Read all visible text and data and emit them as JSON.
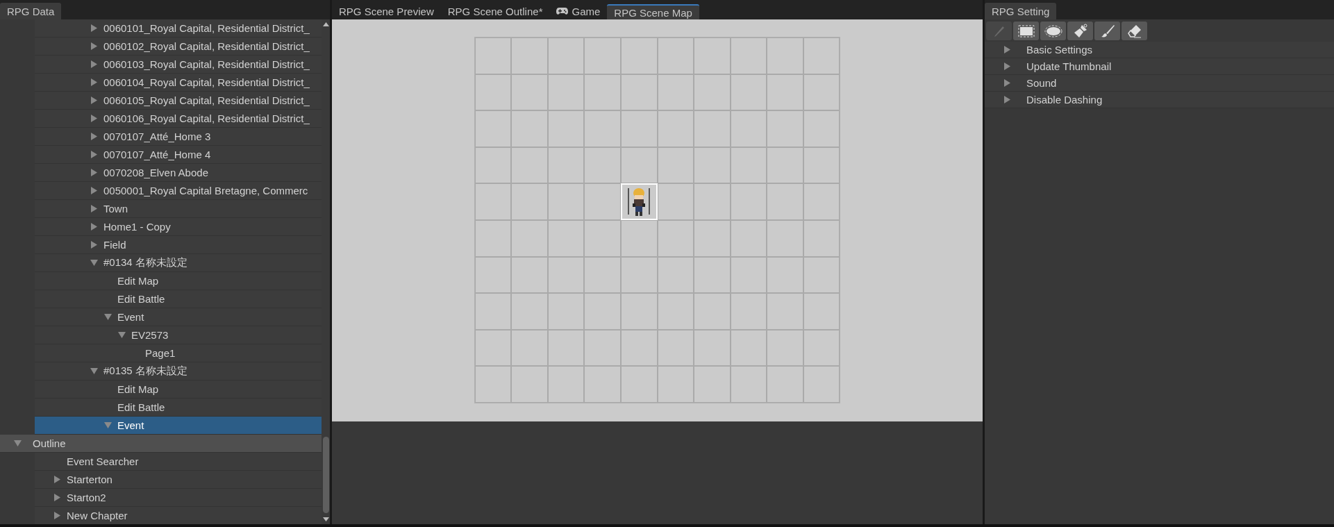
{
  "left_panel": {
    "tab": {
      "label": "RPG Data",
      "selected": true
    },
    "tree": [
      {
        "label": "0060101_Royal Capital, Residential District_",
        "kind": "node",
        "expanded": false,
        "selected": false
      },
      {
        "label": "0060102_Royal Capital, Residential District_",
        "kind": "node",
        "expanded": false,
        "selected": false
      },
      {
        "label": "0060103_Royal Capital, Residential District_",
        "kind": "node",
        "expanded": false,
        "selected": false
      },
      {
        "label": "0060104_Royal Capital, Residential District_",
        "kind": "node",
        "expanded": false,
        "selected": false
      },
      {
        "label": "0060105_Royal Capital, Residential District_",
        "kind": "node",
        "expanded": false,
        "selected": false
      },
      {
        "label": "0060106_Royal Capital, Residential District_",
        "kind": "node",
        "expanded": false,
        "selected": false
      },
      {
        "label": "0070107_Atté_Home 3",
        "kind": "node",
        "expanded": false,
        "selected": false
      },
      {
        "label": "0070107_Atté_Home 4",
        "kind": "node",
        "expanded": false,
        "selected": false
      },
      {
        "label": "0070208_Elven Abode",
        "kind": "node",
        "expanded": false,
        "selected": false
      },
      {
        "label": "0050001_Royal Capital Bretagne, Commerc",
        "kind": "node",
        "expanded": false,
        "selected": false
      },
      {
        "label": "Town",
        "kind": "node",
        "expanded": false,
        "selected": false
      },
      {
        "label": "Home1 - Copy",
        "kind": "node",
        "expanded": false,
        "selected": false
      },
      {
        "label": "Field",
        "kind": "node",
        "expanded": false,
        "selected": false
      },
      {
        "label": "#0134 名称未設定",
        "kind": "node",
        "expanded": true,
        "selected": false,
        "children": [
          {
            "label": "Edit Map",
            "kind": "leaf",
            "selected": false
          },
          {
            "label": "Edit Battle",
            "kind": "leaf",
            "selected": false
          },
          {
            "label": "Event",
            "kind": "node",
            "expanded": true,
            "selected": false,
            "children": [
              {
                "label": "EV2573",
                "kind": "node",
                "expanded": true,
                "selected": false,
                "children": [
                  {
                    "label": "Page1",
                    "kind": "leaf",
                    "selected": false
                  }
                ]
              }
            ]
          }
        ]
      },
      {
        "label": "#0135 名称未設定",
        "kind": "node",
        "expanded": true,
        "selected": false,
        "children": [
          {
            "label": "Edit Map",
            "kind": "leaf",
            "selected": false
          },
          {
            "label": "Edit Battle",
            "kind": "leaf",
            "selected": false
          },
          {
            "label": "Event",
            "kind": "node",
            "expanded": true,
            "selected": true
          }
        ]
      }
    ],
    "outline": {
      "label": "Outline",
      "expanded": true,
      "children": [
        {
          "label": "Event Searcher",
          "kind": "leaf",
          "selected": false
        },
        {
          "label": "Starterton",
          "kind": "node",
          "expanded": false,
          "selected": false
        },
        {
          "label": "Starton2",
          "kind": "node",
          "expanded": false,
          "selected": false
        },
        {
          "label": "New Chapter",
          "kind": "node",
          "expanded": false,
          "selected": false
        }
      ]
    }
  },
  "center_panel": {
    "tabs": [
      {
        "label": "RPG Scene Preview",
        "kind": "plain",
        "selected": false
      },
      {
        "label": "RPG Scene Outline*",
        "kind": "plain",
        "selected": false
      },
      {
        "label": "Game",
        "kind": "gamepad",
        "selected": false
      },
      {
        "label": "RPG Scene Map",
        "kind": "plain",
        "selected": true
      }
    ],
    "map": {
      "tile_rows": [
        [
          {
            "kind": "empty"
          },
          {
            "kind": "empty"
          },
          {
            "kind": "empty"
          },
          {
            "kind": "empty"
          },
          {
            "kind": "empty"
          },
          {
            "kind": "empty"
          },
          {
            "kind": "empty"
          },
          {
            "kind": "empty"
          },
          {
            "kind": "empty"
          },
          {
            "kind": "empty"
          }
        ],
        [
          {
            "kind": "empty"
          },
          {
            "kind": "empty"
          },
          {
            "kind": "empty"
          },
          {
            "kind": "empty"
          },
          {
            "kind": "empty"
          },
          {
            "kind": "empty"
          },
          {
            "kind": "empty"
          },
          {
            "kind": "empty"
          },
          {
            "kind": "empty"
          },
          {
            "kind": "empty"
          }
        ],
        [
          {
            "kind": "empty"
          },
          {
            "kind": "empty"
          },
          {
            "kind": "empty"
          },
          {
            "kind": "empty"
          },
          {
            "kind": "empty"
          },
          {
            "kind": "empty"
          },
          {
            "kind": "empty"
          },
          {
            "kind": "empty"
          },
          {
            "kind": "empty"
          },
          {
            "kind": "empty"
          }
        ],
        [
          {
            "kind": "empty"
          },
          {
            "kind": "empty"
          },
          {
            "kind": "empty"
          },
          {
            "kind": "empty"
          },
          {
            "kind": "empty"
          },
          {
            "kind": "empty"
          },
          {
            "kind": "empty"
          },
          {
            "kind": "empty"
          },
          {
            "kind": "empty"
          },
          {
            "kind": "empty"
          }
        ],
        [
          {
            "kind": "empty"
          },
          {
            "kind": "empty"
          },
          {
            "kind": "empty"
          },
          {
            "kind": "empty"
          },
          {
            "kind": "character"
          },
          {
            "kind": "empty"
          },
          {
            "kind": "empty"
          },
          {
            "kind": "empty"
          },
          {
            "kind": "empty"
          },
          {
            "kind": "empty"
          }
        ],
        [
          {
            "kind": "empty"
          },
          {
            "kind": "empty"
          },
          {
            "kind": "empty"
          },
          {
            "kind": "empty"
          },
          {
            "kind": "empty"
          },
          {
            "kind": "empty"
          },
          {
            "kind": "empty"
          },
          {
            "kind": "empty"
          },
          {
            "kind": "empty"
          },
          {
            "kind": "empty"
          }
        ],
        [
          {
            "kind": "empty"
          },
          {
            "kind": "empty"
          },
          {
            "kind": "empty"
          },
          {
            "kind": "empty"
          },
          {
            "kind": "empty"
          },
          {
            "kind": "empty"
          },
          {
            "kind": "empty"
          },
          {
            "kind": "empty"
          },
          {
            "kind": "empty"
          },
          {
            "kind": "empty"
          }
        ],
        [
          {
            "kind": "empty"
          },
          {
            "kind": "empty"
          },
          {
            "kind": "empty"
          },
          {
            "kind": "empty"
          },
          {
            "kind": "empty"
          },
          {
            "kind": "empty"
          },
          {
            "kind": "empty"
          },
          {
            "kind": "empty"
          },
          {
            "kind": "empty"
          },
          {
            "kind": "empty"
          }
        ],
        [
          {
            "kind": "empty"
          },
          {
            "kind": "empty"
          },
          {
            "kind": "empty"
          },
          {
            "kind": "empty"
          },
          {
            "kind": "empty"
          },
          {
            "kind": "empty"
          },
          {
            "kind": "empty"
          },
          {
            "kind": "empty"
          },
          {
            "kind": "empty"
          },
          {
            "kind": "empty"
          }
        ],
        [
          {
            "kind": "empty"
          },
          {
            "kind": "empty"
          },
          {
            "kind": "empty"
          },
          {
            "kind": "empty"
          },
          {
            "kind": "empty"
          },
          {
            "kind": "empty"
          },
          {
            "kind": "empty"
          },
          {
            "kind": "empty"
          },
          {
            "kind": "empty"
          },
          {
            "kind": "empty"
          }
        ]
      ]
    }
  },
  "right_panel": {
    "tab": {
      "label": "RPG Setting",
      "selected": true
    },
    "tools": [
      {
        "kind": "pencil",
        "selected": true
      },
      {
        "kind": "rect-select",
        "selected": false
      },
      {
        "kind": "ellipse-select",
        "selected": false
      },
      {
        "kind": "fill",
        "selected": false
      },
      {
        "kind": "brush",
        "selected": false
      },
      {
        "kind": "eraser",
        "selected": false
      }
    ],
    "sections": [
      {
        "label": "Basic Settings",
        "expanded": false
      },
      {
        "label": "Update Thumbnail",
        "expanded": false
      },
      {
        "label": "Sound",
        "expanded": false
      },
      {
        "label": "Disable Dashing",
        "expanded": false
      }
    ]
  }
}
